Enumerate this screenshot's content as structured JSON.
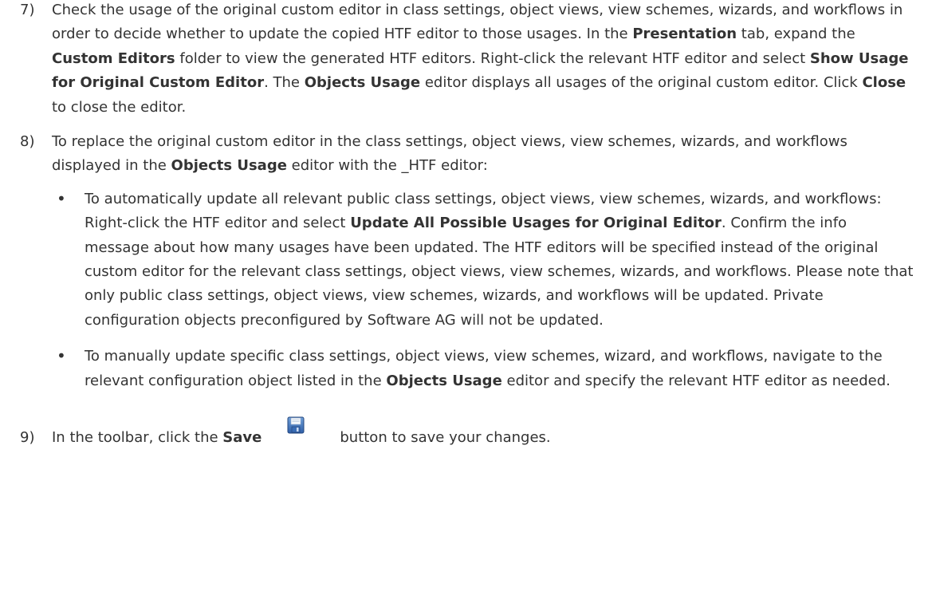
{
  "steps": [
    {
      "number": "7)",
      "segments": [
        {
          "text": "Check the usage of the original custom editor in class settings, object views, view schemes, wizards, and workflows in order to decide whether to update the copied HTF editor to those usages. In the "
        },
        {
          "text": "Presentation",
          "bold": true
        },
        {
          "text": " tab, expand the "
        },
        {
          "text": "Custom Editors",
          "bold": true
        },
        {
          "text": " folder to view the generated HTF editors. Right-click the relevant HTF editor and select "
        },
        {
          "text": "Show Usage for Original Custom Editor",
          "bold": true
        },
        {
          "text": ". The "
        },
        {
          "text": "Objects Usage",
          "bold": true
        },
        {
          "text": " editor displays all usages of the original custom editor. Click "
        },
        {
          "text": "Close",
          "bold": true
        },
        {
          "text": " to close the editor."
        }
      ]
    },
    {
      "number": "8)",
      "segments": [
        {
          "text": "To replace the original custom editor in the class settings, object views, view schemes, wizards, and workflows displayed in the "
        },
        {
          "text": "Objects Usage",
          "bold": true
        },
        {
          "text": " editor with the _HTF editor:"
        }
      ]
    },
    {
      "number": "9)",
      "before": "In the toolbar, click the ",
      "bold": "Save",
      "icon": "save-icon",
      "after": "button to save your changes."
    }
  ],
  "bullets": [
    {
      "segments": [
        {
          "text": "To automatically update all relevant public class settings, object views, view schemes, wizards, and workflows: Right-click the HTF editor and select "
        },
        {
          "text": "Update All Possible Usages for Original Editor",
          "bold": true
        },
        {
          "text": ". Confirm the info message about how many usages have been updated. The HTF editors will be specified instead of the original custom editor for the relevant class settings, object views, view schemes, wizards, and workflows. Please note that only public class settings, object views, view schemes, wizards, and workflows will be updated. Private configuration objects preconfigured by Software AG will not be updated."
        }
      ]
    },
    {
      "segments": [
        {
          "text": "To manually update specific class settings, object views, view schemes, wizard, and workflows, navigate to the relevant configuration object listed in the "
        },
        {
          "text": "Objects Usage",
          "bold": true
        },
        {
          "text": " editor and specify the relevant HTF editor as needed."
        }
      ]
    }
  ],
  "bullet_symbol": "•"
}
